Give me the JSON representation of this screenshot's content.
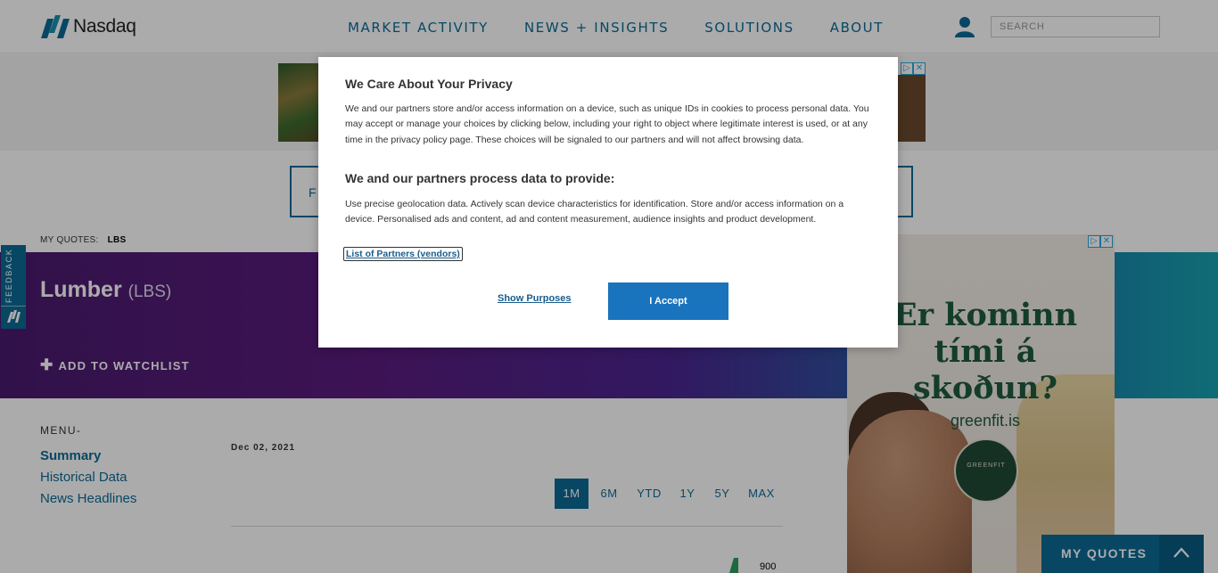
{
  "header": {
    "logo_text": "Nasdaq",
    "nav": [
      "MARKET ACTIVITY",
      "NEWS + INSIGHTS",
      "SOLUTIONS",
      "ABOUT"
    ],
    "search_placeholder": "SEARCH"
  },
  "strip": {
    "text": "F"
  },
  "my_quotes": {
    "label": "MY QUOTES:",
    "symbol": "LBS"
  },
  "hero": {
    "title": "Lumber",
    "symbol": "(LBS)",
    "add_watchlist": "ADD TO WATCHLIST"
  },
  "feedback": {
    "label": "FEEDBACK"
  },
  "menu": {
    "heading": "MENU-",
    "items": [
      "Summary",
      "Historical Data",
      "News Headlines"
    ],
    "active": "Summary"
  },
  "chart": {
    "date": "Dec 02, 2021",
    "ranges": [
      "1M",
      "6M",
      "YTD",
      "1Y",
      "5Y",
      "MAX"
    ],
    "active_range": "1M",
    "axis_value": "900"
  },
  "ad": {
    "headline_lines": [
      "Er kominn",
      "tími á",
      "skoðun?"
    ],
    "url": "greenfit.is",
    "badge": "GREENFIT"
  },
  "footer": {
    "my_quotes": "MY QUOTES"
  },
  "modal": {
    "title": "We Care About Your Privacy",
    "body": "We and our partners store and/or access information on a device, such as unique IDs in cookies to process personal data. You may accept or manage your choices by clicking below, including your right to object where legitimate interest is used, or at any time in the privacy policy page. These choices will be signaled to our partners and will not affect browsing data.",
    "subtitle": "We and our partners process data to provide:",
    "body2": "Use precise geolocation data. Actively scan device characteristics for identification. Store and/or access information on a device. Personalised ads and content, ad and content measurement, audience insights and product development.",
    "vendors_link": "List of Partners (vendors)",
    "show_purposes": "Show Purposes",
    "accept": "I Accept"
  },
  "colors": {
    "brand": "#0c6b96",
    "accept": "#1a73bd",
    "hero_start": "#4a1a6e",
    "hero_end": "#17a2b0"
  }
}
